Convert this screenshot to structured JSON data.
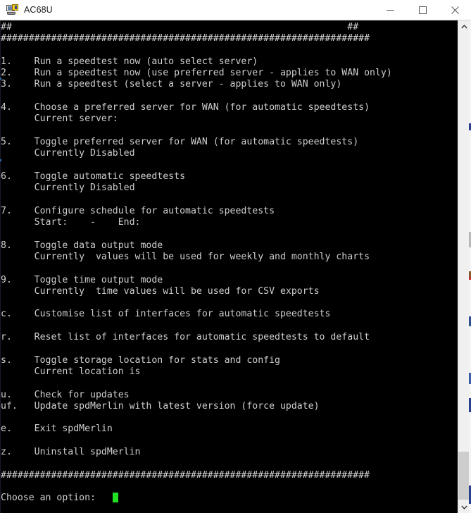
{
  "window": {
    "title": "AC68U",
    "icon": "putty-terminal-icon",
    "controls": {
      "minimize": "minimize-button",
      "maximize": "maximize-button",
      "close": "close-button"
    }
  },
  "colors": {
    "terminal_bg": "#000000",
    "terminal_fg": "#cfcfcf",
    "cursor": "#22e022",
    "titlebar_bg": "#ffffff",
    "scrollbar_track": "#f0f0f0",
    "scrollbar_thumb": "#cdcdcd"
  },
  "terminal": {
    "divider_partial": "##                                                            ##",
    "divider_full": "##################################################################",
    "lines": [
      "##                                                            ##",
      "##################################################################",
      "",
      "1.    Run a speedtest now (auto select server)",
      "2.    Run a speedtest now (use preferred server - applies to WAN only)",
      "3.    Run a speedtest (select a server - applies to WAN only)",
      "",
      "4.    Choose a preferred server for WAN (for automatic speedtests)",
      "      Current server:",
      "",
      "5.    Toggle preferred server for WAN (for automatic speedtests)",
      "      Currently Disabled",
      "",
      "6.    Toggle automatic speedtests",
      "      Currently Disabled",
      "",
      "7.    Configure schedule for automatic speedtests",
      "      Start:    -    End:",
      "",
      "8.    Toggle data output mode",
      "      Currently  values will be used for weekly and monthly charts",
      "",
      "9.    Toggle time output mode",
      "      Currently  time values will be used for CSV exports",
      "",
      "c.    Customise list of interfaces for automatic speedtests",
      "",
      "r.    Reset list of interfaces for automatic speedtests to default",
      "",
      "s.    Toggle storage location for stats and config",
      "      Current location is",
      "",
      "u.    Check for updates",
      "uf.   Update spdMerlin with latest version (force update)",
      "",
      "e.    Exit spdMerlin",
      "",
      "z.    Uninstall spdMerlin",
      "",
      "##################################################################",
      "",
      "Choose an option:"
    ],
    "prompt": "Choose an option:",
    "cursor_column": 20
  },
  "menu": {
    "items": [
      {
        "key": "1.",
        "label": "Run a speedtest now (auto select server)",
        "detail": ""
      },
      {
        "key": "2.",
        "label": "Run a speedtest now (use preferred server - applies to WAN only)",
        "detail": ""
      },
      {
        "key": "3.",
        "label": "Run a speedtest (select a server - applies to WAN only)",
        "detail": ""
      },
      {
        "key": "4.",
        "label": "Choose a preferred server for WAN (for automatic speedtests)",
        "detail": "Current server:"
      },
      {
        "key": "5.",
        "label": "Toggle preferred server for WAN (for automatic speedtests)",
        "detail": "Currently Disabled"
      },
      {
        "key": "6.",
        "label": "Toggle automatic speedtests",
        "detail": "Currently Disabled"
      },
      {
        "key": "7.",
        "label": "Configure schedule for automatic speedtests",
        "detail": "Start:    -    End:"
      },
      {
        "key": "8.",
        "label": "Toggle data output mode",
        "detail": "Currently  values will be used for weekly and monthly charts"
      },
      {
        "key": "9.",
        "label": "Toggle time output mode",
        "detail": "Currently  time values will be used for CSV exports"
      },
      {
        "key": "c.",
        "label": "Customise list of interfaces for automatic speedtests",
        "detail": ""
      },
      {
        "key": "r.",
        "label": "Reset list of interfaces for automatic speedtests to default",
        "detail": ""
      },
      {
        "key": "s.",
        "label": "Toggle storage location for stats and config",
        "detail": "Current location is"
      },
      {
        "key": "u.",
        "label": "Check for updates",
        "detail": ""
      },
      {
        "key": "uf.",
        "label": "Update spdMerlin with latest version (force update)",
        "detail": ""
      },
      {
        "key": "e.",
        "label": "Exit spdMerlin",
        "detail": ""
      },
      {
        "key": "z.",
        "label": "Uninstall spdMerlin",
        "detail": ""
      }
    ]
  }
}
